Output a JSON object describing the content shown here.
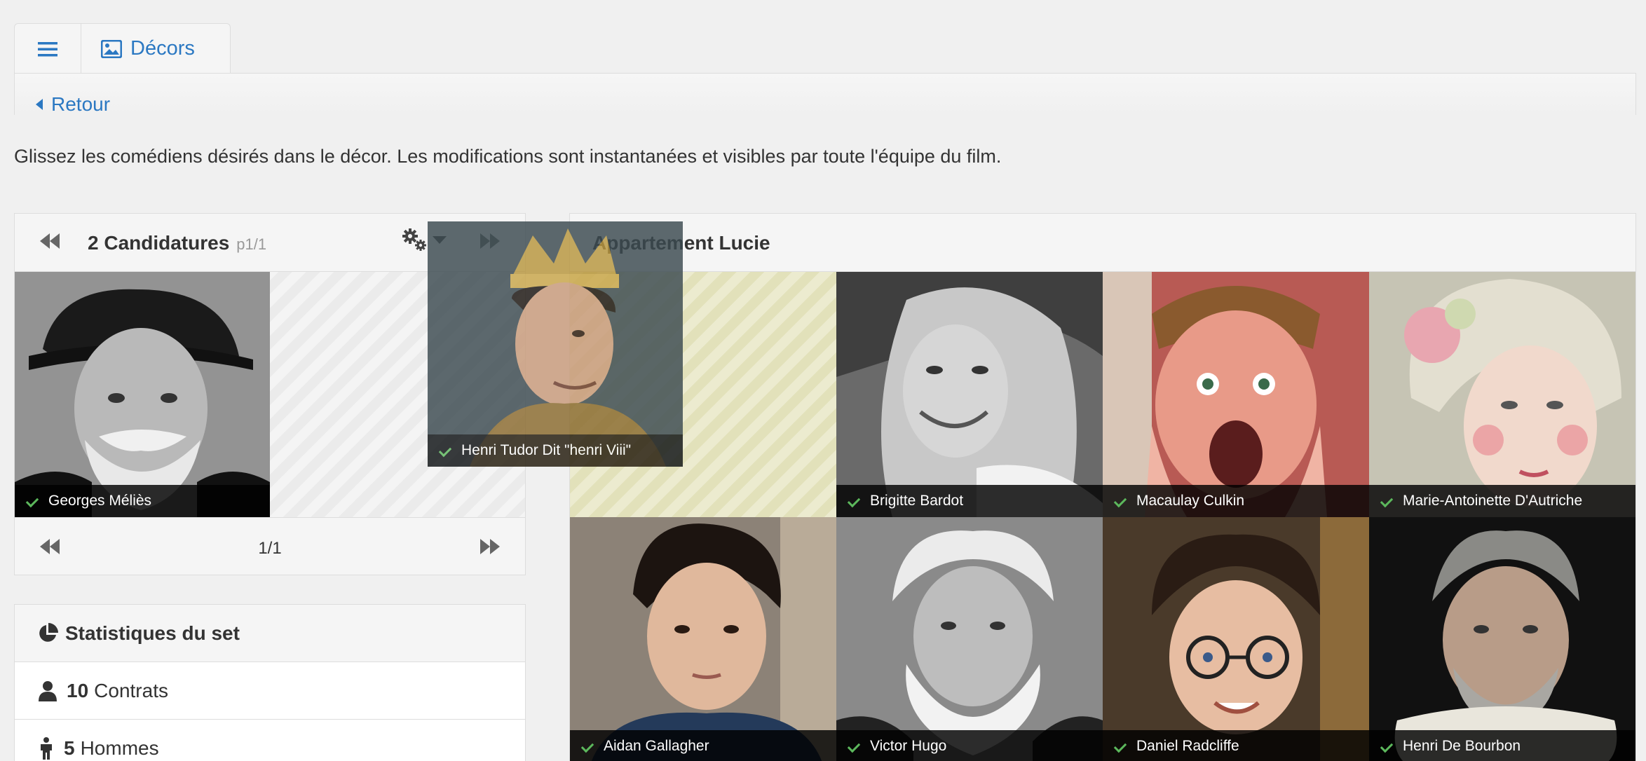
{
  "tabs": {
    "menu_icon": "hamburger-icon",
    "decors_label": "Décors",
    "decors_icon": "image-icon"
  },
  "header": {
    "back_label": "Retour"
  },
  "instructions": "Glissez les comédiens désirés dans le décor. Les modifications sont instantanées et visibles par toute l'équipe du film.",
  "candidatures": {
    "title": "2 Candidatures",
    "subtitle": "p1/1",
    "pager": "1/1",
    "items": [
      {
        "name": "Georges Méliès"
      }
    ]
  },
  "dragging": {
    "name": "Henri Tudor Dit \"henri Viii\""
  },
  "decor": {
    "title": "Appartement Lucie",
    "actors": [
      {
        "name": "Brigitte Bardot"
      },
      {
        "name": "Macaulay Culkin"
      },
      {
        "name": "Marie-Antoinette D'Autriche"
      },
      {
        "name": "Aidan Gallagher"
      },
      {
        "name": "Victor Hugo"
      },
      {
        "name": "Daniel Radcliffe"
      },
      {
        "name": "Henri De Bourbon"
      }
    ]
  },
  "stats": {
    "title": "Statistiques du set",
    "rows": [
      {
        "value": "10",
        "label": "Contrats"
      },
      {
        "value": "5",
        "label": "Hommes"
      }
    ]
  },
  "colors": {
    "accent": "#2b78c2",
    "check": "#5cb85c"
  }
}
